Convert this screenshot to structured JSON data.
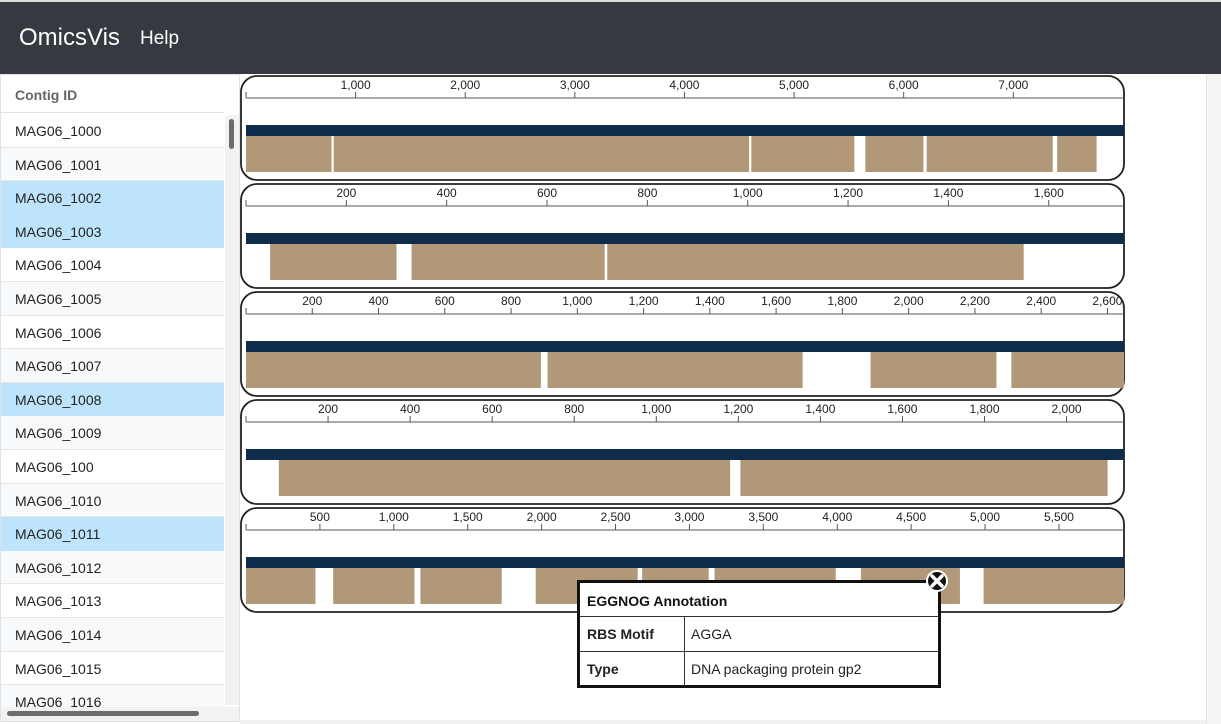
{
  "navbar": {
    "brand": "OmicsVis",
    "help": "Help"
  },
  "sidebar": {
    "header": "Contig ID",
    "rows": [
      {
        "id": "MAG06_1000",
        "selected": false
      },
      {
        "id": "MAG06_1001",
        "selected": false
      },
      {
        "id": "MAG06_1002",
        "selected": true
      },
      {
        "id": "MAG06_1003",
        "selected": true
      },
      {
        "id": "MAG06_1004",
        "selected": false
      },
      {
        "id": "MAG06_1005",
        "selected": false
      },
      {
        "id": "MAG06_1006",
        "selected": false
      },
      {
        "id": "MAG06_1007",
        "selected": false
      },
      {
        "id": "MAG06_1008",
        "selected": true
      },
      {
        "id": "MAG06_1009",
        "selected": false
      },
      {
        "id": "MAG06_100",
        "selected": false
      },
      {
        "id": "MAG06_1010",
        "selected": false
      },
      {
        "id": "MAG06_1011",
        "selected": true
      },
      {
        "id": "MAG06_1012",
        "selected": false
      },
      {
        "id": "MAG06_1013",
        "selected": false
      },
      {
        "id": "MAG06_1014",
        "selected": false
      },
      {
        "id": "MAG06_1015",
        "selected": false
      },
      {
        "id": "MAG06_1016",
        "selected": false
      }
    ]
  },
  "colors": {
    "contig_bar": "#0f2c4a",
    "gene": "#b09878",
    "selected_row": "#bde4fb",
    "navbar": "#343a40"
  },
  "chart_data": [
    {
      "type": "genome-track",
      "contig": "MAG06_1002",
      "length": 8010,
      "ticks": [
        1000,
        2000,
        3000,
        4000,
        5000,
        6000,
        7000
      ],
      "tick_labels": [
        "1,000",
        "2,000",
        "3,000",
        "4,000",
        "5,000",
        "6,000",
        "7,000"
      ],
      "genes": [
        [
          0,
          780
        ],
        [
          800,
          4590
        ],
        [
          4610,
          5550
        ],
        [
          5650,
          6180
        ],
        [
          6210,
          7360
        ],
        [
          7400,
          7760
        ]
      ]
    },
    {
      "type": "genome-track",
      "contig": "MAG06_1003",
      "length": 1750,
      "ticks": [
        200,
        400,
        600,
        800,
        1000,
        1200,
        1400,
        1600
      ],
      "tick_labels": [
        "200",
        "400",
        "600",
        "800",
        "1,000",
        "1,200",
        "1,400",
        "1,600"
      ],
      "genes": [
        [
          48,
          300
        ],
        [
          330,
          715
        ],
        [
          720,
          1550
        ]
      ]
    },
    {
      "type": "genome-track",
      "contig": "MAG06_1008",
      "length": 2650,
      "ticks": [
        200,
        400,
        600,
        800,
        1000,
        1200,
        1400,
        1600,
        1800,
        2000,
        2200,
        2400,
        2600
      ],
      "tick_labels": [
        "200",
        "400",
        "600",
        "800",
        "1,000",
        "1,200",
        "1,400",
        "1,600",
        "1,800",
        "2,000",
        "2,200",
        "2,400",
        "2,600"
      ],
      "genes": [
        [
          0,
          890
        ],
        [
          910,
          1680
        ],
        [
          1885,
          2265
        ],
        [
          2310,
          2650
        ]
      ]
    },
    {
      "type": "genome-track",
      "contig": "MAG06_1011",
      "length": 2140,
      "ticks": [
        200,
        400,
        600,
        800,
        1000,
        1200,
        1400,
        1600,
        1800,
        2000
      ],
      "tick_labels": [
        "200",
        "400",
        "600",
        "800",
        "1,000",
        "1,200",
        "1,400",
        "1,600",
        "1,800",
        "2,000"
      ],
      "genes": [
        [
          80,
          1180
        ],
        [
          1205,
          2100
        ]
      ]
    },
    {
      "type": "genome-track",
      "contig": "MAG06_1012",
      "length": 5940,
      "ticks": [
        500,
        1000,
        1500,
        2000,
        2500,
        3000,
        3500,
        4000,
        4500,
        5000,
        5500
      ],
      "tick_labels": [
        "500",
        "1,000",
        "1,500",
        "2,000",
        "2,500",
        "3,000",
        "3,500",
        "4,000",
        "4,500",
        "5,000",
        "5,500"
      ],
      "genes": [
        [
          0,
          470
        ],
        [
          590,
          1140
        ],
        [
          1180,
          1730
        ],
        [
          1960,
          2650
        ],
        [
          2680,
          3130
        ],
        [
          3170,
          3990
        ],
        [
          4160,
          4830
        ],
        [
          4990,
          5940
        ]
      ]
    }
  ],
  "popup": {
    "title": "EGGNOG Annotation",
    "rows": [
      {
        "key": "RBS Motif",
        "value": "AGGA"
      },
      {
        "key": "Type",
        "value": "DNA packaging protein gp2"
      }
    ]
  }
}
